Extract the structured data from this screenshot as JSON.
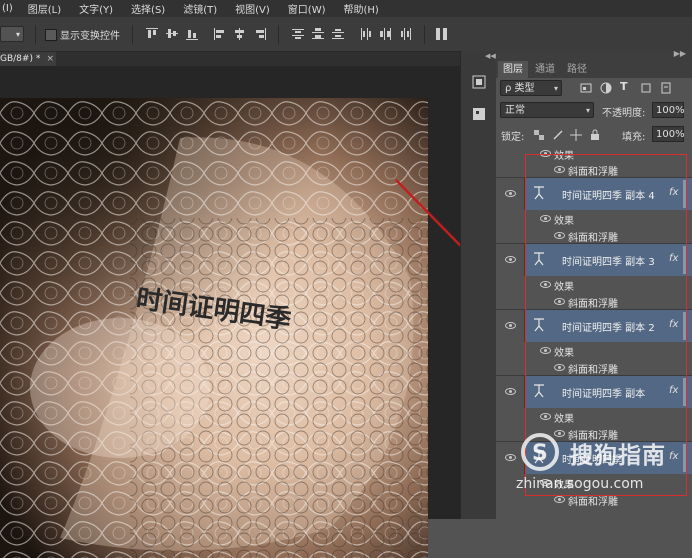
{
  "menubar": {
    "items": [
      "图层(L)",
      "文字(Y)",
      "选择(S)",
      "滤镜(T)",
      "视图(V)",
      "窗口(W)",
      "帮助(H)"
    ],
    "partial_first": "(I)"
  },
  "options_bar": {
    "show_transform_controls": "显示变换控件"
  },
  "document_tab": {
    "label": "GB/8#) *",
    "close": "×"
  },
  "panel": {
    "tabs": [
      "图层",
      "通道",
      "路径"
    ],
    "filter_label": "ρ 类型",
    "blend_mode": "正常",
    "opacity_label": "不透明度:",
    "opacity_value": "100%",
    "lock_label": "锁定:",
    "fill_label": "填充:",
    "fill_value": "100%"
  },
  "layers": {
    "top_effects": "效果",
    "top_bevel": "斜面和浮雕",
    "rows": [
      {
        "name": "时间证明四季 副本 4",
        "fx": "fx",
        "effects": "效果",
        "bevel": "斜面和浮雕"
      },
      {
        "name": "时间证明四季 副本 3",
        "fx": "fx",
        "effects": "效果",
        "bevel": "斜面和浮雕"
      },
      {
        "name": "时间证明四季 副本 2",
        "fx": "fx",
        "effects": "效果",
        "bevel": "斜面和浮雕"
      },
      {
        "name": "时间证明四季 副本",
        "fx": "fx",
        "effects": "效果",
        "bevel": "斜面和浮雕"
      },
      {
        "name": "时间证明四季",
        "fx": "fx",
        "effects": "效果",
        "bevel": "斜面和浮雕"
      }
    ]
  },
  "canvas": {
    "curved_text": "时间证明四季"
  },
  "watermark": {
    "brand": "搜狗指南",
    "url": "zhinan.sogou.com"
  },
  "colors": {
    "selected_layer": "#536884",
    "annotation_red": "#d83030"
  }
}
